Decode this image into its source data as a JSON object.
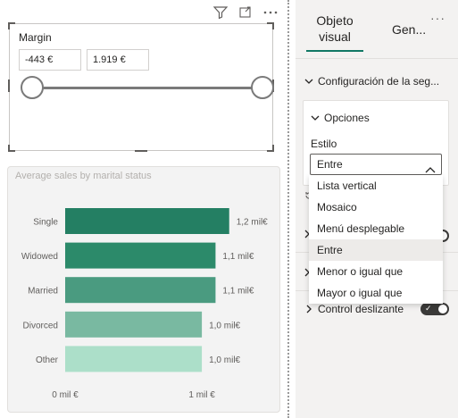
{
  "slicer": {
    "title": "Margin",
    "min_value": "-443 €",
    "max_value": "1.919 €"
  },
  "visual_header": {
    "icons": [
      "filter-icon",
      "focus-mode-icon",
      "more-options-icon"
    ]
  },
  "chart_data": {
    "type": "bar",
    "orientation": "horizontal",
    "title": "Average sales by marital status",
    "categories": [
      "Single",
      "Widowed",
      "Married",
      "Divorced",
      "Other"
    ],
    "values": [
      1.2,
      1.1,
      1.1,
      1.0,
      1.0
    ],
    "data_labels": [
      "1,2 mil€",
      "1,1 mil€",
      "1,1 mil€",
      "1,0 mil€",
      "1,0 mil€"
    ],
    "bar_colors": [
      "#247f63",
      "#2c8a6a",
      "#4a9b80",
      "#79b9a1",
      "#acdfc9"
    ],
    "x_ticks": [
      "0 mil €",
      "1 mil €"
    ],
    "x_tick_values": [
      0,
      1
    ],
    "xlim": [
      0,
      1.45
    ],
    "grid": false,
    "xlabel": "",
    "ylabel": ""
  },
  "pane": {
    "tab_visual": "Objeto visual",
    "tab_general": "Gen...",
    "more": "···",
    "section_config": "Configuración de la seg...",
    "options_header": "Opciones",
    "style_label": "Estilo",
    "style_selected": "Entre",
    "dropdown_options": [
      "Lista vertical",
      "Mosaico",
      "Menú desplegable",
      "Entre",
      "Menor o igual que",
      "Mayor o igual que"
    ],
    "selected_index": 3,
    "section_slider": "Control deslizante"
  },
  "colors": {
    "accent": "#117865",
    "toggle_on": "#3b3a39"
  }
}
